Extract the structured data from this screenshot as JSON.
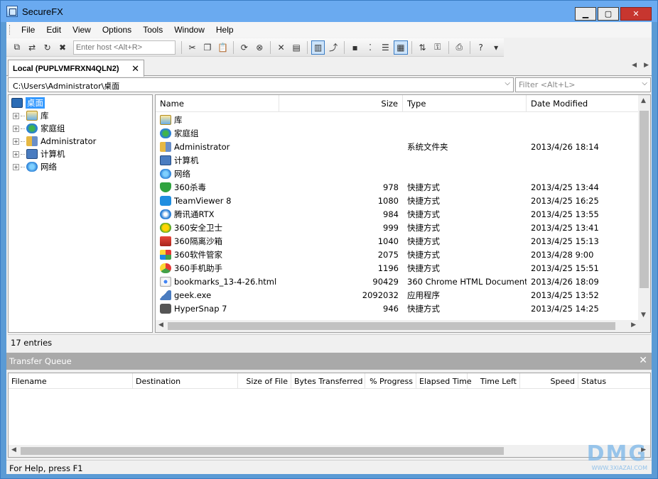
{
  "window": {
    "title": "SecureFX",
    "min": "▁",
    "max": "▢",
    "close": "✕"
  },
  "menu": [
    "File",
    "Edit",
    "View",
    "Options",
    "Tools",
    "Window",
    "Help"
  ],
  "toolbar": {
    "host_placeholder": "Enter host <Alt+R>"
  },
  "tab": {
    "label": "Local (PUPLVMFRXN4QLN2)",
    "close": "✕",
    "prev": "◀",
    "next": "▶"
  },
  "path": {
    "value": "C:\\Users\\Administrator\\桌面",
    "filter_placeholder": "Filter <Alt+L>"
  },
  "tree": {
    "root": "桌面",
    "children": [
      "库",
      "家庭组",
      "Administrator",
      "计算机",
      "网络"
    ]
  },
  "filelist": {
    "columns": [
      "Name",
      "Size",
      "Type",
      "Date Modified"
    ],
    "rows": [
      {
        "name": "库",
        "size": "",
        "type": "",
        "date": "",
        "icon": "library"
      },
      {
        "name": "家庭组",
        "size": "",
        "type": "",
        "date": "",
        "icon": "homegroup"
      },
      {
        "name": "Administrator",
        "size": "",
        "type": "系统文件夹",
        "date": "2013/4/26 18:14",
        "icon": "user"
      },
      {
        "name": "计算机",
        "size": "",
        "type": "",
        "date": "",
        "icon": "computer"
      },
      {
        "name": "网络",
        "size": "",
        "type": "",
        "date": "",
        "icon": "network"
      },
      {
        "name": "360杀毒",
        "size": "978",
        "type": "快捷方式",
        "date": "2013/4/25 13:44",
        "icon": "shield"
      },
      {
        "name": "TeamViewer 8",
        "size": "1080",
        "type": "快捷方式",
        "date": "2013/4/25 16:25",
        "icon": "tv"
      },
      {
        "name": "腾讯通RTX",
        "size": "984",
        "type": "快捷方式",
        "date": "2013/4/25 13:55",
        "icon": "qq"
      },
      {
        "name": "360安全卫士",
        "size": "999",
        "type": "快捷方式",
        "date": "2013/4/25 13:41",
        "icon": "safe"
      },
      {
        "name": "360隔离沙箱",
        "size": "1040",
        "type": "快捷方式",
        "date": "2013/4/25 15:13",
        "icon": "box"
      },
      {
        "name": "360软件管家",
        "size": "2075",
        "type": "快捷方式",
        "date": "2013/4/28 9:00",
        "icon": "soft"
      },
      {
        "name": "360手机助手",
        "size": "1196",
        "type": "快捷方式",
        "date": "2013/4/25 15:51",
        "icon": "phone"
      },
      {
        "name": "bookmarks_13-4-26.html",
        "size": "90429",
        "type": "360 Chrome HTML Document",
        "date": "2013/4/26 18:09",
        "icon": "chrome"
      },
      {
        "name": "geek.exe",
        "size": "2092032",
        "type": "应用程序",
        "date": "2013/4/25 13:52",
        "icon": "exe"
      },
      {
        "name": "HyperSnap 7",
        "size": "946",
        "type": "快捷方式",
        "date": "2013/4/25 14:25",
        "icon": "camera"
      }
    ]
  },
  "entries": "17 entries",
  "transfer_queue": {
    "title": "Transfer Queue",
    "close": "✕",
    "columns": [
      "Filename",
      "Destination",
      "Size of File",
      "Bytes Transferred",
      "% Progress",
      "Elapsed Time",
      "Time Left",
      "Speed",
      "Status"
    ]
  },
  "status": "For Help, press F1",
  "watermark": {
    "logo": "DMG",
    "url": "WWW.3XIAZAI.COM"
  }
}
